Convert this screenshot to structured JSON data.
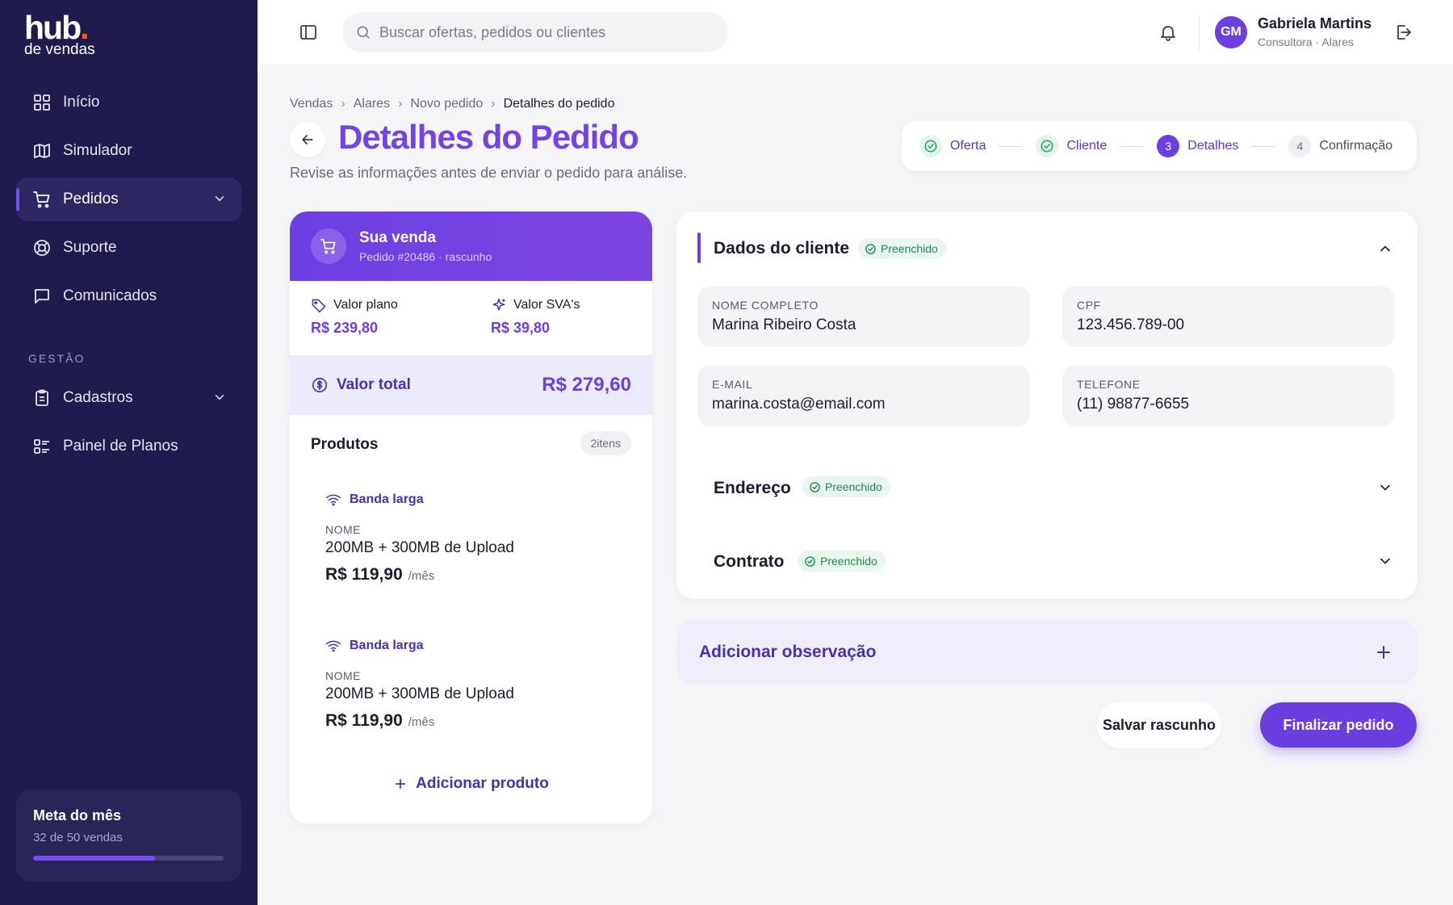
{
  "brand": {
    "name_main": "hub",
    "name_dot": ".",
    "name_sub": "de vendas",
    "accent": "#7443e8",
    "dot_color": "#ff5a1f",
    "sidebar_bg": "#1f1b4d"
  },
  "sidebar": {
    "items": [
      {
        "label": "Início",
        "icon": "grid-icon"
      },
      {
        "label": "Simulador",
        "icon": "map-icon"
      },
      {
        "label": "Pedidos",
        "icon": "cart-icon",
        "active": true,
        "expandable": true
      },
      {
        "label": "Suporte",
        "icon": "lifebuoy-icon"
      },
      {
        "label": "Comunicados",
        "icon": "message-icon"
      }
    ],
    "section_label": "GESTÃO",
    "section_items": [
      {
        "label": "Cadastros",
        "icon": "clipboard-icon",
        "expandable": true
      },
      {
        "label": "Painel de Planos",
        "icon": "list-icon"
      }
    ],
    "goal": {
      "title": "Meta do mês",
      "progress_text": "32 de 50 vendas",
      "current": 32,
      "target": 50
    }
  },
  "topbar": {
    "search_placeholder": "Buscar ofertas, pedidos ou clientes",
    "user": {
      "initials": "GM",
      "name": "Gabriela Martins",
      "role": "Consultora · Alares"
    }
  },
  "breadcrumb": [
    "Vendas",
    "Alares",
    "Novo pedido",
    "Detalhes do pedido"
  ],
  "header": {
    "title": "Detalhes do Pedido",
    "subtitle": "Revise as informações antes de enviar o pedido para análise."
  },
  "stepper": [
    {
      "label": "Oferta",
      "state": "done",
      "number": "1"
    },
    {
      "label": "Cliente",
      "state": "done",
      "number": "2"
    },
    {
      "label": "Detalhes",
      "state": "current",
      "number": "3"
    },
    {
      "label": "Confirmação",
      "state": "todo",
      "number": "4"
    }
  ],
  "sale": {
    "title": "Sua venda",
    "subtitle": "Pedido #20486 · rascunho",
    "plan_label": "Valor plano",
    "plan_value": "R$ 239,80",
    "sva_label": "Valor SVA's",
    "sva_value": "R$ 39,80",
    "total_label": "Valor total",
    "total_value": "R$ 279,60",
    "products_title": "Produtos",
    "items_count": "2itens",
    "products": [
      {
        "type": "Banda larga",
        "key": "NOME",
        "name": "200MB + 300MB de Upload",
        "price": "R$ 119,90",
        "period": "/mês"
      },
      {
        "type": "Banda larga",
        "key": "NOME",
        "name": "200MB + 300MB de Upload",
        "price": "R$ 119,90",
        "period": "/mês"
      }
    ],
    "add_product": "Adicionar produto"
  },
  "client": {
    "title": "Dados do cliente",
    "status": "Preenchido",
    "fields": [
      {
        "label": "NOME COMPLETO",
        "value": "Marina Ribeiro Costa"
      },
      {
        "label": "CPF",
        "value": "123.456.789-00"
      },
      {
        "label": "E-MAIL",
        "value": "marina.costa@email.com"
      },
      {
        "label": "TELEFONE",
        "value": "(11) 98877-6655"
      }
    ],
    "address": {
      "title": "Endereço",
      "status": "Preenchido"
    },
    "contract": {
      "title": "Contrato",
      "status": "Preenchido"
    }
  },
  "observation": {
    "title": "Adicionar observação"
  },
  "actions": {
    "draft": "Salvar rascunho",
    "finish": "Finalizar pedido"
  }
}
